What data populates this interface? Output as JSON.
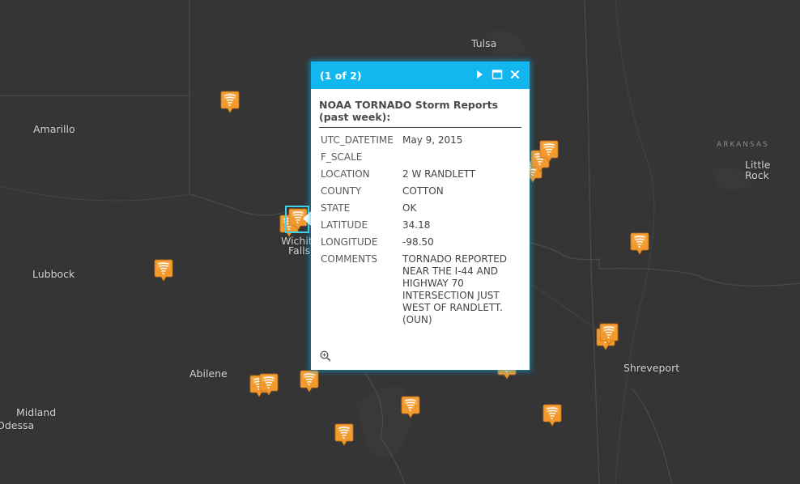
{
  "map": {
    "cities": [
      {
        "name": "Tulsa"
      },
      {
        "name": "Amarillo"
      },
      {
        "name": "Little"
      },
      {
        "name": "Rock"
      },
      {
        "name": "Lubbock"
      },
      {
        "name": "Wichita"
      },
      {
        "name": "Falls"
      },
      {
        "name": "Abilene"
      },
      {
        "name": "Shreveport"
      },
      {
        "name": "Midland"
      },
      {
        "name": "Odessa"
      }
    ],
    "region_label": "ARKANSAS",
    "marker_icon": "tornado-marker-icon",
    "marker_color": "#f39a2e",
    "selection_color": "#3fd1e8"
  },
  "popup": {
    "count": "(1 of 2)",
    "title": "NOAA TORNADO Storm Reports (past week):",
    "header_color": "#12b7ef",
    "fields": [
      {
        "key": "UTC_DATETIME",
        "value": "May 9, 2015"
      },
      {
        "key": "F_SCALE",
        "value": ""
      },
      {
        "key": "LOCATION",
        "value": "2 W RANDLETT"
      },
      {
        "key": "COUNTY",
        "value": "COTTON"
      },
      {
        "key": "STATE",
        "value": "OK"
      },
      {
        "key": "LATITUDE",
        "value": "34.18"
      },
      {
        "key": "LONGITUDE",
        "value": "-98.50"
      },
      {
        "key": "COMMENTS",
        "value": "TORNADO REPORTED NEAR THE I-44 AND HIGHWAY 70 INTERSECTION JUST WEST OF RANDLETT. (OUN)"
      }
    ],
    "icons": [
      "next-arrow-icon",
      "maximize-icon",
      "close-icon",
      "zoom-to-icon"
    ]
  }
}
